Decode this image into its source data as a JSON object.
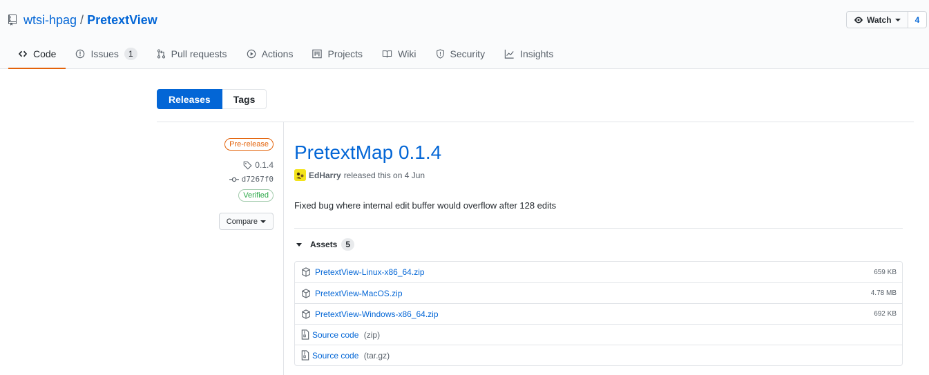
{
  "repo": {
    "owner": "wtsi-hpag",
    "separator": "/",
    "name": "PretextView"
  },
  "watch": {
    "label": "Watch",
    "count": "4"
  },
  "tabs": [
    {
      "label": "Code",
      "icon": "code-icon"
    },
    {
      "label": "Issues",
      "icon": "issue-icon",
      "count": "1"
    },
    {
      "label": "Pull requests",
      "icon": "pull-request-icon"
    },
    {
      "label": "Actions",
      "icon": "play-icon"
    },
    {
      "label": "Projects",
      "icon": "project-icon"
    },
    {
      "label": "Wiki",
      "icon": "book-icon"
    },
    {
      "label": "Security",
      "icon": "shield-icon"
    },
    {
      "label": "Insights",
      "icon": "graph-icon"
    }
  ],
  "subnav": {
    "releases": "Releases",
    "tags": "Tags"
  },
  "meta": {
    "badge": "Pre-release",
    "tag": "0.1.4",
    "commit": "d7267f0",
    "verified": "Verified",
    "compare": "Compare"
  },
  "release": {
    "title": "PretextMap 0.1.4",
    "author": "EdHarry",
    "released_text": "released this on 4 Jun",
    "body": "Fixed bug where internal edit buffer would overflow after 128 edits"
  },
  "assets": {
    "label": "Assets",
    "count": "5",
    "files": [
      {
        "name": "PretextView-Linux-x86_64.zip",
        "size": "659 KB"
      },
      {
        "name": "PretextView-MacOS.zip",
        "size": "4.78 MB"
      },
      {
        "name": "PretextView-Windows-x86_64.zip",
        "size": "692 KB"
      }
    ],
    "sources": [
      {
        "name": "Source code",
        "format": "(zip)"
      },
      {
        "name": "Source code",
        "format": "(tar.gz)"
      }
    ]
  },
  "colors": {
    "accent": "#0366d6",
    "selected_tab": "#e36209",
    "verified": "#28a745"
  }
}
